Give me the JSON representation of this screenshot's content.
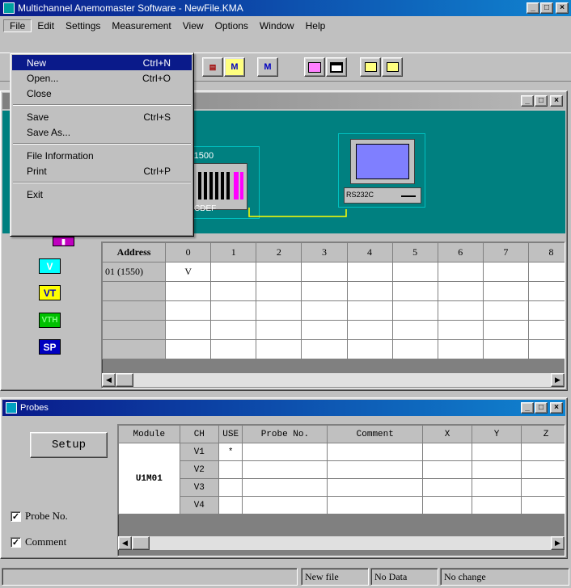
{
  "window": {
    "title": "Multichannel Anemomaster Software - NewFile.KMA"
  },
  "menubar": [
    "File",
    "Edit",
    "Settings",
    "Measurement",
    "View",
    "Options",
    "Window",
    "Help"
  ],
  "file_menu": {
    "items": [
      {
        "label": "New",
        "shortcut": "Ctrl+N"
      },
      {
        "label": "Open...",
        "shortcut": "Ctrl+O"
      },
      {
        "label": "Close",
        "shortcut": ""
      },
      {
        "label": "Save",
        "shortcut": "Ctrl+S"
      },
      {
        "label": "Save As...",
        "shortcut": ""
      },
      {
        "label": "File Information",
        "shortcut": ""
      },
      {
        "label": "Print",
        "shortcut": "Ctrl+P"
      },
      {
        "label": "Exit",
        "shortcut": ""
      }
    ]
  },
  "toolbar": {
    "m_label": "M",
    "meas_label": "M"
  },
  "config": {
    "device_label": "-1500",
    "device_code": "CDEF",
    "pc_port": "RS232C",
    "types": [
      "V",
      "VT",
      "VTH",
      "SP"
    ],
    "table_header": [
      "Address",
      "0",
      "1",
      "2",
      "3",
      "4",
      "5",
      "6",
      "7",
      "8"
    ],
    "rows": [
      [
        "01 (1550)",
        "V",
        "",
        "",
        "",
        "",
        "",
        "",
        "",
        ""
      ],
      [
        "",
        "",
        "",
        "",
        "",
        "",
        "",
        "",
        "",
        ""
      ],
      [
        "",
        "",
        "",
        "",
        "",
        "",
        "",
        "",
        "",
        ""
      ],
      [
        "",
        "",
        "",
        "",
        "",
        "",
        "",
        "",
        "",
        ""
      ],
      [
        "",
        "",
        "",
        "",
        "",
        "",
        "",
        "",
        "",
        ""
      ]
    ]
  },
  "probes": {
    "title": "Probes",
    "setup_label": "Setup",
    "check_probe_no": "Probe No.",
    "check_comment": "Comment",
    "header": [
      "Module",
      "CH",
      "USE",
      "Probe No.",
      "Comment",
      "X",
      "Y",
      "Z"
    ],
    "module_name": "U1M01",
    "channels": [
      {
        "ch": "V1",
        "use": "*"
      },
      {
        "ch": "V2",
        "use": ""
      },
      {
        "ch": "V3",
        "use": ""
      },
      {
        "ch": "V4",
        "use": ""
      }
    ]
  },
  "statusbar": {
    "file": "New file",
    "data": "No Data",
    "change": "No change"
  },
  "colors": {
    "teal": "#008080",
    "title_active": "#0a1a8a",
    "magenta": "#ff00ff"
  }
}
